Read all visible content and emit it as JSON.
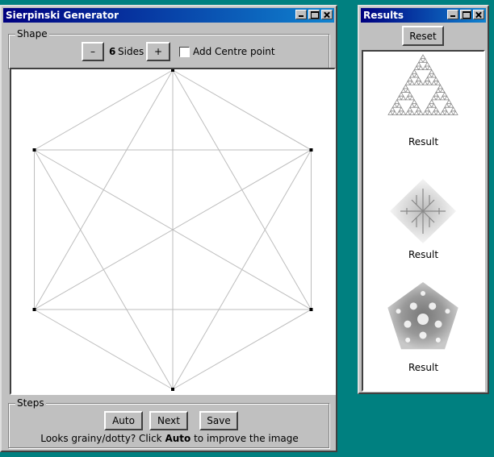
{
  "main_window": {
    "title": "Sierpinski Generator",
    "shape_group": {
      "legend": "Shape",
      "minus_label": "–",
      "sides_count": "6",
      "sides_label": "Sides",
      "plus_label": "+",
      "centre_label": "Add Centre point",
      "centre_checked": false
    },
    "steps_group": {
      "legend": "Steps",
      "auto_label": "Auto",
      "next_label": "Next",
      "save_label": "Save",
      "hint_prefix": "Looks grainy/dotty? Click ",
      "hint_bold": "Auto",
      "hint_suffix": " to improve the image"
    }
  },
  "results_window": {
    "title": "Results",
    "reset_label": "Reset",
    "results": [
      {
        "caption": "Result",
        "shape": "triangle"
      },
      {
        "caption": "Result",
        "shape": "diamond"
      },
      {
        "caption": "Result",
        "shape": "pentagon"
      }
    ]
  },
  "colors": {
    "desktop": "#008080",
    "title_gradient_start": "#000080",
    "title_gradient_end": "#1084d0"
  },
  "icons": [
    "minimize-icon",
    "maximize-icon",
    "close-icon"
  ]
}
